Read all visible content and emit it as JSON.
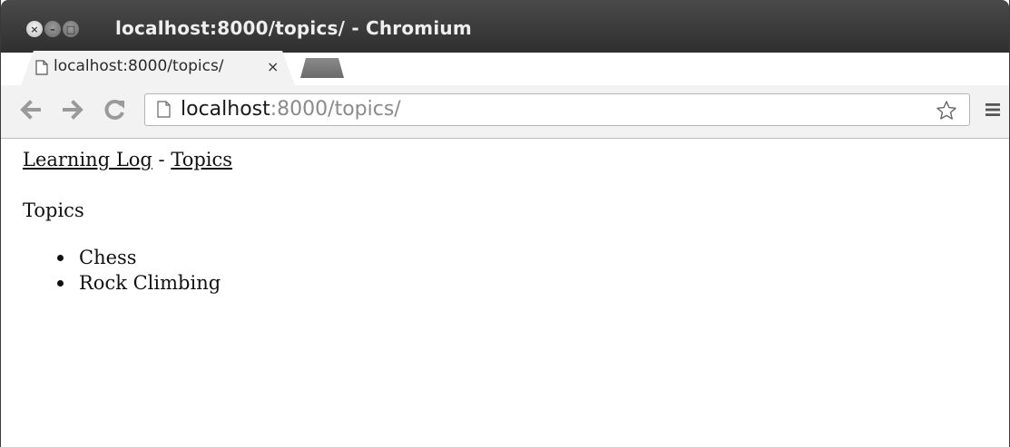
{
  "window": {
    "title": "localhost:8000/topics/ - Chromium",
    "close_glyph": "×",
    "minimize_glyph": "–",
    "maximize_glyph": "□"
  },
  "tabs": [
    {
      "title": "localhost:8000/topics/",
      "close_glyph": "×",
      "icon": "page-icon"
    }
  ],
  "toolbar": {
    "back_icon": "back-arrow-icon",
    "forward_icon": "forward-arrow-icon",
    "reload_icon": "reload-icon",
    "url_host": "localhost",
    "url_rest": ":8000/topics/",
    "star_icon": "star-icon",
    "menu_icon": "menu-icon"
  },
  "page": {
    "nav": {
      "home_link": "Learning Log",
      "separator": " - ",
      "topics_link": "Topics"
    },
    "heading": "Topics",
    "topics": [
      "Chess",
      "Rock Climbing"
    ]
  },
  "colors": {
    "titlebar": "#3a3a3a",
    "toolbar": "#f2f2f2",
    "url_dim": "#8a8a8a"
  }
}
